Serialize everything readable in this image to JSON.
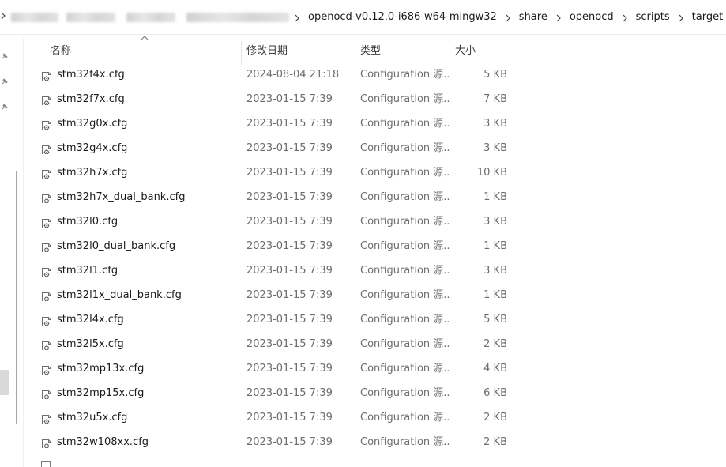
{
  "breadcrumb": {
    "blurred_segments": 4,
    "segments": [
      "openocd-v0.12.0-i686-w64-mingw32",
      "share",
      "openocd",
      "scripts",
      "target"
    ]
  },
  "columns": {
    "name": "名称",
    "date": "修改日期",
    "type": "类型",
    "size": "大小"
  },
  "files": [
    {
      "name": "stm32f4x.cfg",
      "date": "2024-08-04 21:18",
      "type": "Configuration 源...",
      "size": "5 KB"
    },
    {
      "name": "stm32f7x.cfg",
      "date": "2023-01-15 7:39",
      "type": "Configuration 源...",
      "size": "7 KB"
    },
    {
      "name": "stm32g0x.cfg",
      "date": "2023-01-15 7:39",
      "type": "Configuration 源...",
      "size": "3 KB"
    },
    {
      "name": "stm32g4x.cfg",
      "date": "2023-01-15 7:39",
      "type": "Configuration 源...",
      "size": "3 KB"
    },
    {
      "name": "stm32h7x.cfg",
      "date": "2023-01-15 7:39",
      "type": "Configuration 源...",
      "size": "10 KB"
    },
    {
      "name": "stm32h7x_dual_bank.cfg",
      "date": "2023-01-15 7:39",
      "type": "Configuration 源...",
      "size": "1 KB"
    },
    {
      "name": "stm32l0.cfg",
      "date": "2023-01-15 7:39",
      "type": "Configuration 源...",
      "size": "3 KB"
    },
    {
      "name": "stm32l0_dual_bank.cfg",
      "date": "2023-01-15 7:39",
      "type": "Configuration 源...",
      "size": "1 KB"
    },
    {
      "name": "stm32l1.cfg",
      "date": "2023-01-15 7:39",
      "type": "Configuration 源...",
      "size": "3 KB"
    },
    {
      "name": "stm32l1x_dual_bank.cfg",
      "date": "2023-01-15 7:39",
      "type": "Configuration 源...",
      "size": "1 KB"
    },
    {
      "name": "stm32l4x.cfg",
      "date": "2023-01-15 7:39",
      "type": "Configuration 源...",
      "size": "5 KB"
    },
    {
      "name": "stm32l5x.cfg",
      "date": "2023-01-15 7:39",
      "type": "Configuration 源...",
      "size": "2 KB"
    },
    {
      "name": "stm32mp13x.cfg",
      "date": "2023-01-15 7:39",
      "type": "Configuration 源...",
      "size": "4 KB"
    },
    {
      "name": "stm32mp15x.cfg",
      "date": "2023-01-15 7:39",
      "type": "Configuration 源...",
      "size": "6 KB"
    },
    {
      "name": "stm32u5x.cfg",
      "date": "2023-01-15 7:39",
      "type": "Configuration 源...",
      "size": "2 KB"
    },
    {
      "name": "stm32w108xx.cfg",
      "date": "2023-01-15 7:39",
      "type": "Configuration 源...",
      "size": "2 KB"
    }
  ],
  "icons": {
    "file": "config-file-icon",
    "sort": "sort-ascending-icon",
    "separator": "chevron-right-icon",
    "pin": "pin-icon"
  }
}
